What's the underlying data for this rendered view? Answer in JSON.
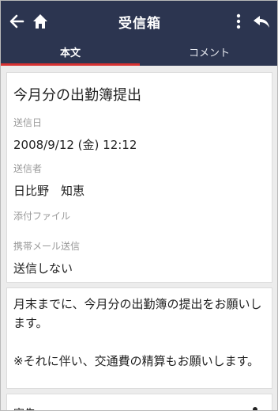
{
  "header": {
    "title": "受信箱",
    "icons": {
      "back": "arrow-left-icon",
      "home": "home-icon",
      "more": "more-vertical-icon",
      "reply": "reply-icon"
    }
  },
  "tabs": [
    {
      "label": "本文",
      "active": true
    },
    {
      "label": "コメント",
      "active": false
    }
  ],
  "message": {
    "subject": "今月分の出勤簿提出",
    "sent_date_label": "送信日",
    "sent_date_value": "2008/9/12 (金) 12:12",
    "sender_label": "送信者",
    "sender_value": "日比野　知恵",
    "attachment_label": "添付ファイル",
    "mobile_label": "携帯メール送信",
    "mobile_value": "送信しない",
    "body": "月末までに、今月分の出勤簿の提出をお願いします。\n\n※それに伴い、交通費の精算もお願いします。"
  },
  "bottom": {
    "label": "宛先"
  },
  "colors": {
    "appbar": "#2c3550",
    "tab_indicator": "#d73231",
    "label_gray": "#9a9a9a"
  }
}
